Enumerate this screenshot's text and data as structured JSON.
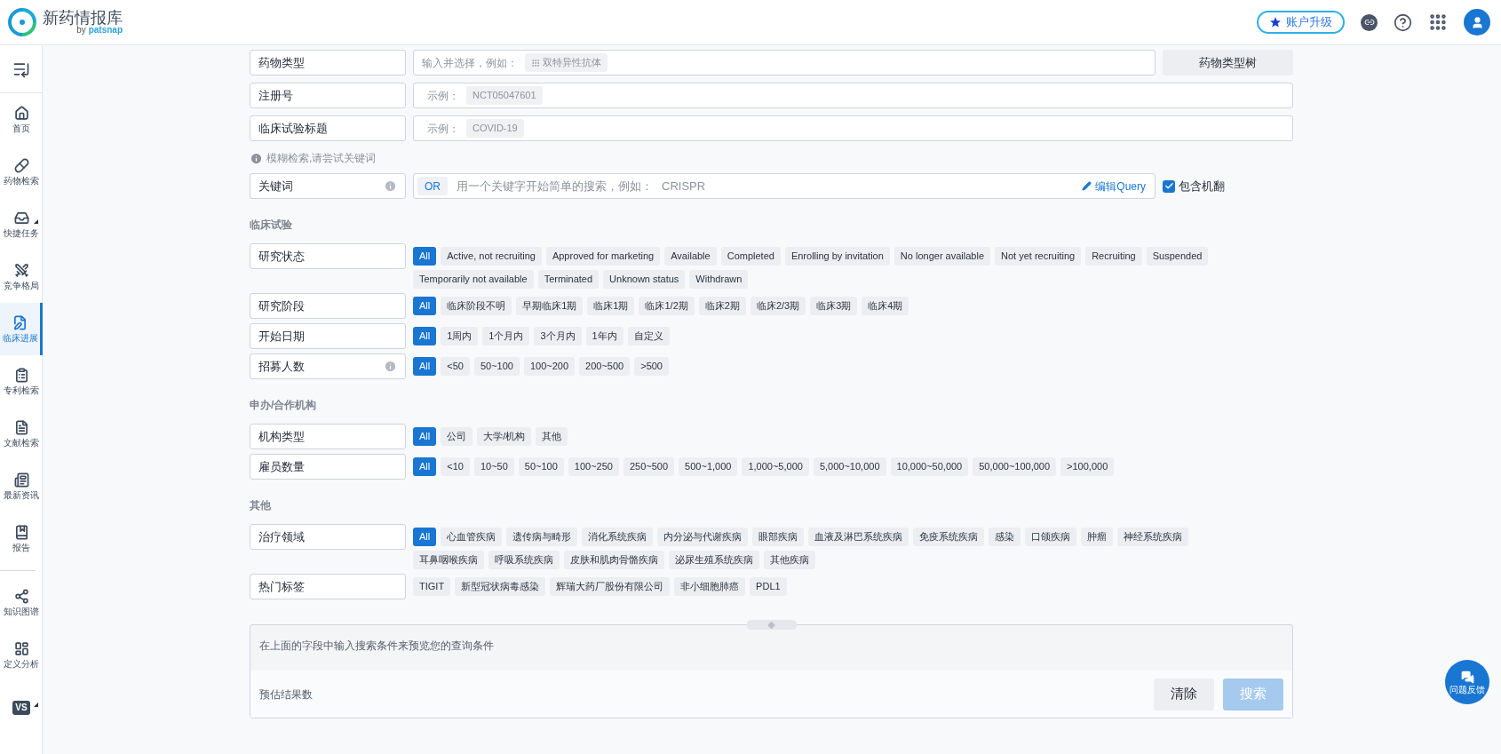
{
  "header": {
    "logo_title": "新药情报库",
    "logo_by": "by",
    "logo_brand": "patsnap",
    "upgrade": "账户升级"
  },
  "sidebar": {
    "items": [
      {
        "kind": "home",
        "label": "首页",
        "selected": false,
        "submenu": false
      },
      {
        "kind": "pill",
        "label": "药物检索",
        "selected": false,
        "submenu": false
      },
      {
        "kind": "tasks",
        "label": "快捷任务",
        "selected": false,
        "submenu": true
      },
      {
        "kind": "swords",
        "label": "竞争格局",
        "selected": false,
        "submenu": false
      },
      {
        "kind": "clinical",
        "label": "临床进展",
        "selected": true,
        "submenu": false
      },
      {
        "kind": "patent",
        "label": "专利检索",
        "selected": false,
        "submenu": false
      },
      {
        "kind": "document",
        "label": "文献检索",
        "selected": false,
        "submenu": false
      },
      {
        "kind": "news",
        "label": "最新资讯",
        "selected": false,
        "submenu": false
      },
      {
        "kind": "report",
        "label": "报告",
        "selected": false,
        "submenu": false
      }
    ],
    "tools": [
      {
        "kind": "graph",
        "label": "知识图谱",
        "selected": false,
        "submenu": false
      },
      {
        "kind": "layout",
        "label": "定义分析",
        "selected": false,
        "submenu": false
      },
      {
        "kind": "vs",
        "badge": "VS",
        "selected": false,
        "submenu": true
      }
    ]
  },
  "top_fields": [
    {
      "label": "药物类型",
      "placeholder": "输入并选择，例如：",
      "example": "双特异性抗体",
      "example_icon": true,
      "button": "药物类型树"
    },
    {
      "label": "注册号",
      "placeholder": "示例：",
      "example": "NCT05047601",
      "example_icon": false
    },
    {
      "label": "临床试验标题",
      "placeholder": "示例：",
      "example": "COVID-19",
      "example_icon": false
    }
  ],
  "hint": "模糊检索,请尝试关键词",
  "keyword": {
    "label": "关键词",
    "info": true,
    "operator": "OR",
    "placeholder": "用一个关键字开始简单的搜索，例如：",
    "example": "CRISPR",
    "edit": "编辑Query",
    "translate": {
      "label": "包含机翻",
      "checked": true
    }
  },
  "sections": [
    {
      "title": "临床试验",
      "filters": [
        {
          "label": "研究状态",
          "info": false,
          "options": [
            {
              "label": "All",
              "selected": true
            },
            {
              "label": "Active, not recruiting",
              "selected": false
            },
            {
              "label": "Approved for marketing",
              "selected": false
            },
            {
              "label": "Available",
              "selected": false
            },
            {
              "label": "Completed",
              "selected": false
            },
            {
              "label": "Enrolling by invitation",
              "selected": false
            },
            {
              "label": "No longer available",
              "selected": false
            },
            {
              "label": "Not yet recruiting",
              "selected": false
            },
            {
              "label": "Recruiting",
              "selected": false
            },
            {
              "label": "Suspended",
              "selected": false
            },
            {
              "label": "Temporarily not available",
              "selected": false
            },
            {
              "label": "Terminated",
              "selected": false
            },
            {
              "label": "Unknown status",
              "selected": false
            },
            {
              "label": "Withdrawn",
              "selected": false
            }
          ]
        },
        {
          "label": "研究阶段",
          "info": false,
          "options": [
            {
              "label": "All",
              "selected": true
            },
            {
              "label": "临床阶段不明",
              "selected": false
            },
            {
              "label": "早期临床1期",
              "selected": false
            },
            {
              "label": "临床1期",
              "selected": false
            },
            {
              "label": "临床1/2期",
              "selected": false
            },
            {
              "label": "临床2期",
              "selected": false
            },
            {
              "label": "临床2/3期",
              "selected": false
            },
            {
              "label": "临床3期",
              "selected": false
            },
            {
              "label": "临床4期",
              "selected": false
            }
          ]
        },
        {
          "label": "开始日期",
          "info": false,
          "options": [
            {
              "label": "All",
              "selected": true
            },
            {
              "label": "1周内",
              "selected": false
            },
            {
              "label": "1个月内",
              "selected": false
            },
            {
              "label": "3个月内",
              "selected": false
            },
            {
              "label": "1年内",
              "selected": false
            },
            {
              "label": "自定义",
              "selected": false
            }
          ]
        },
        {
          "label": "招募人数",
          "info": true,
          "options": [
            {
              "label": "All",
              "selected": true
            },
            {
              "label": "<50",
              "selected": false
            },
            {
              "label": "50~100",
              "selected": false
            },
            {
              "label": "100~200",
              "selected": false
            },
            {
              "label": "200~500",
              "selected": false
            },
            {
              "label": ">500",
              "selected": false
            }
          ]
        }
      ]
    },
    {
      "title": "申办/合作机构",
      "filters": [
        {
          "label": "机构类型",
          "info": false,
          "options": [
            {
              "label": "All",
              "selected": true
            },
            {
              "label": "公司",
              "selected": false
            },
            {
              "label": "大学/机构",
              "selected": false
            },
            {
              "label": "其他",
              "selected": false
            }
          ]
        },
        {
          "label": "雇员数量",
          "info": false,
          "options": [
            {
              "label": "All",
              "selected": true
            },
            {
              "label": "<10",
              "selected": false
            },
            {
              "label": "10~50",
              "selected": false
            },
            {
              "label": "50~100",
              "selected": false
            },
            {
              "label": "100~250",
              "selected": false
            },
            {
              "label": "250~500",
              "selected": false
            },
            {
              "label": "500~1,000",
              "selected": false
            },
            {
              "label": "1,000~5,000",
              "selected": false
            },
            {
              "label": "5,000~10,000",
              "selected": false
            },
            {
              "label": "10,000~50,000",
              "selected": false
            },
            {
              "label": "50,000~100,000",
              "selected": false
            },
            {
              "label": ">100,000",
              "selected": false
            }
          ]
        }
      ]
    },
    {
      "title": "其他",
      "filters": [
        {
          "label": "治疗领域",
          "info": false,
          "options": [
            {
              "label": "All",
              "selected": true
            },
            {
              "label": "心血管疾病",
              "selected": false
            },
            {
              "label": "遗传病与畸形",
              "selected": false
            },
            {
              "label": "消化系统疾病",
              "selected": false
            },
            {
              "label": "内分泌与代谢疾病",
              "selected": false
            },
            {
              "label": "眼部疾病",
              "selected": false
            },
            {
              "label": "血液及淋巴系统疾病",
              "selected": false
            },
            {
              "label": "免疫系统疾病",
              "selected": false
            },
            {
              "label": "感染",
              "selected": false
            },
            {
              "label": "口颌疾病",
              "selected": false
            },
            {
              "label": "肿瘤",
              "selected": false
            },
            {
              "label": "神经系统疾病",
              "selected": false
            },
            {
              "label": "耳鼻咽喉疾病",
              "selected": false
            },
            {
              "label": "呼吸系统疾病",
              "selected": false
            },
            {
              "label": "皮肤和肌肉骨骼疾病",
              "selected": false
            },
            {
              "label": "泌尿生殖系统疾病",
              "selected": false
            },
            {
              "label": "其他疾病",
              "selected": false
            }
          ]
        },
        {
          "label": "热门标签",
          "info": false,
          "options": [
            {
              "label": "TIGIT",
              "selected": false
            },
            {
              "label": "新型冠状病毒感染",
              "selected": false
            },
            {
              "label": "辉瑞大药厂股份有限公司",
              "selected": false
            },
            {
              "label": "非小细胞肺癌",
              "selected": false
            },
            {
              "label": "PDL1",
              "selected": false
            }
          ]
        }
      ]
    }
  ],
  "preview": {
    "text": "在上面的字段中输入搜索条件来预览您的查询条件",
    "estimate": "预估结果数",
    "clear": "清除",
    "search": "搜索",
    "search_disabled": true
  },
  "feedback": "问题反馈"
}
